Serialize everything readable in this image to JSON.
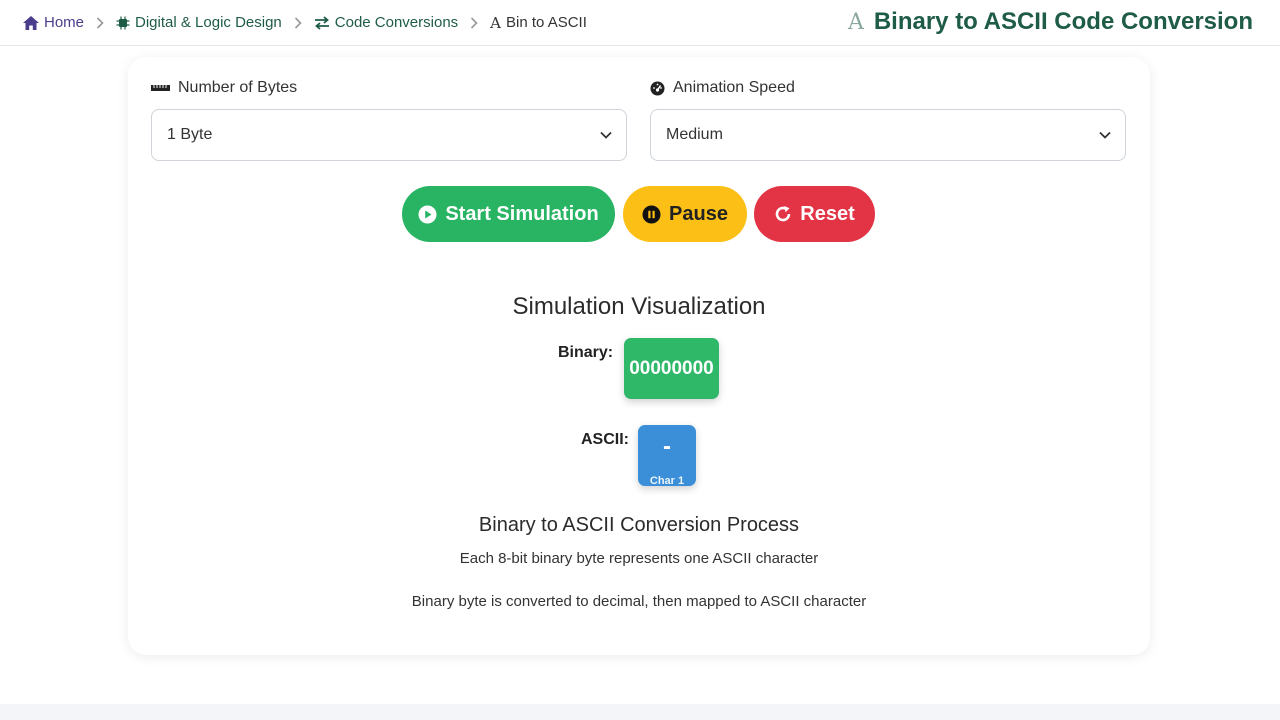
{
  "breadcrumb": {
    "home": "Home",
    "digital_logic": "Digital & Logic Design",
    "code_conversions": "Code Conversions",
    "current": "Bin to ASCII"
  },
  "page_title": "Binary to ASCII Code Conversion",
  "controls": {
    "bytes_label": "Number of Bytes",
    "bytes_value": "1 Byte",
    "speed_label": "Animation Speed",
    "speed_value": "Medium"
  },
  "buttons": {
    "start": "Start Simulation",
    "pause": "Pause",
    "reset": "Reset"
  },
  "visualization": {
    "title": "Simulation Visualization",
    "binary_label": "Binary:",
    "binary_value": "00000000",
    "ascii_label": "ASCII:",
    "ascii_value": "-",
    "ascii_caption": "Char 1"
  },
  "process": {
    "title": "Binary to ASCII Conversion Process",
    "line1": "Each 8-bit binary byte represents one ASCII character",
    "line2": "Binary byte is converted to decimal, then mapped to ASCII character"
  },
  "colors": {
    "brand": "#1f5c46",
    "start": "#28b463",
    "pause": "#fbbf16",
    "reset": "#e23445",
    "binary": "#2fb868",
    "ascii": "#3a8fd8"
  }
}
